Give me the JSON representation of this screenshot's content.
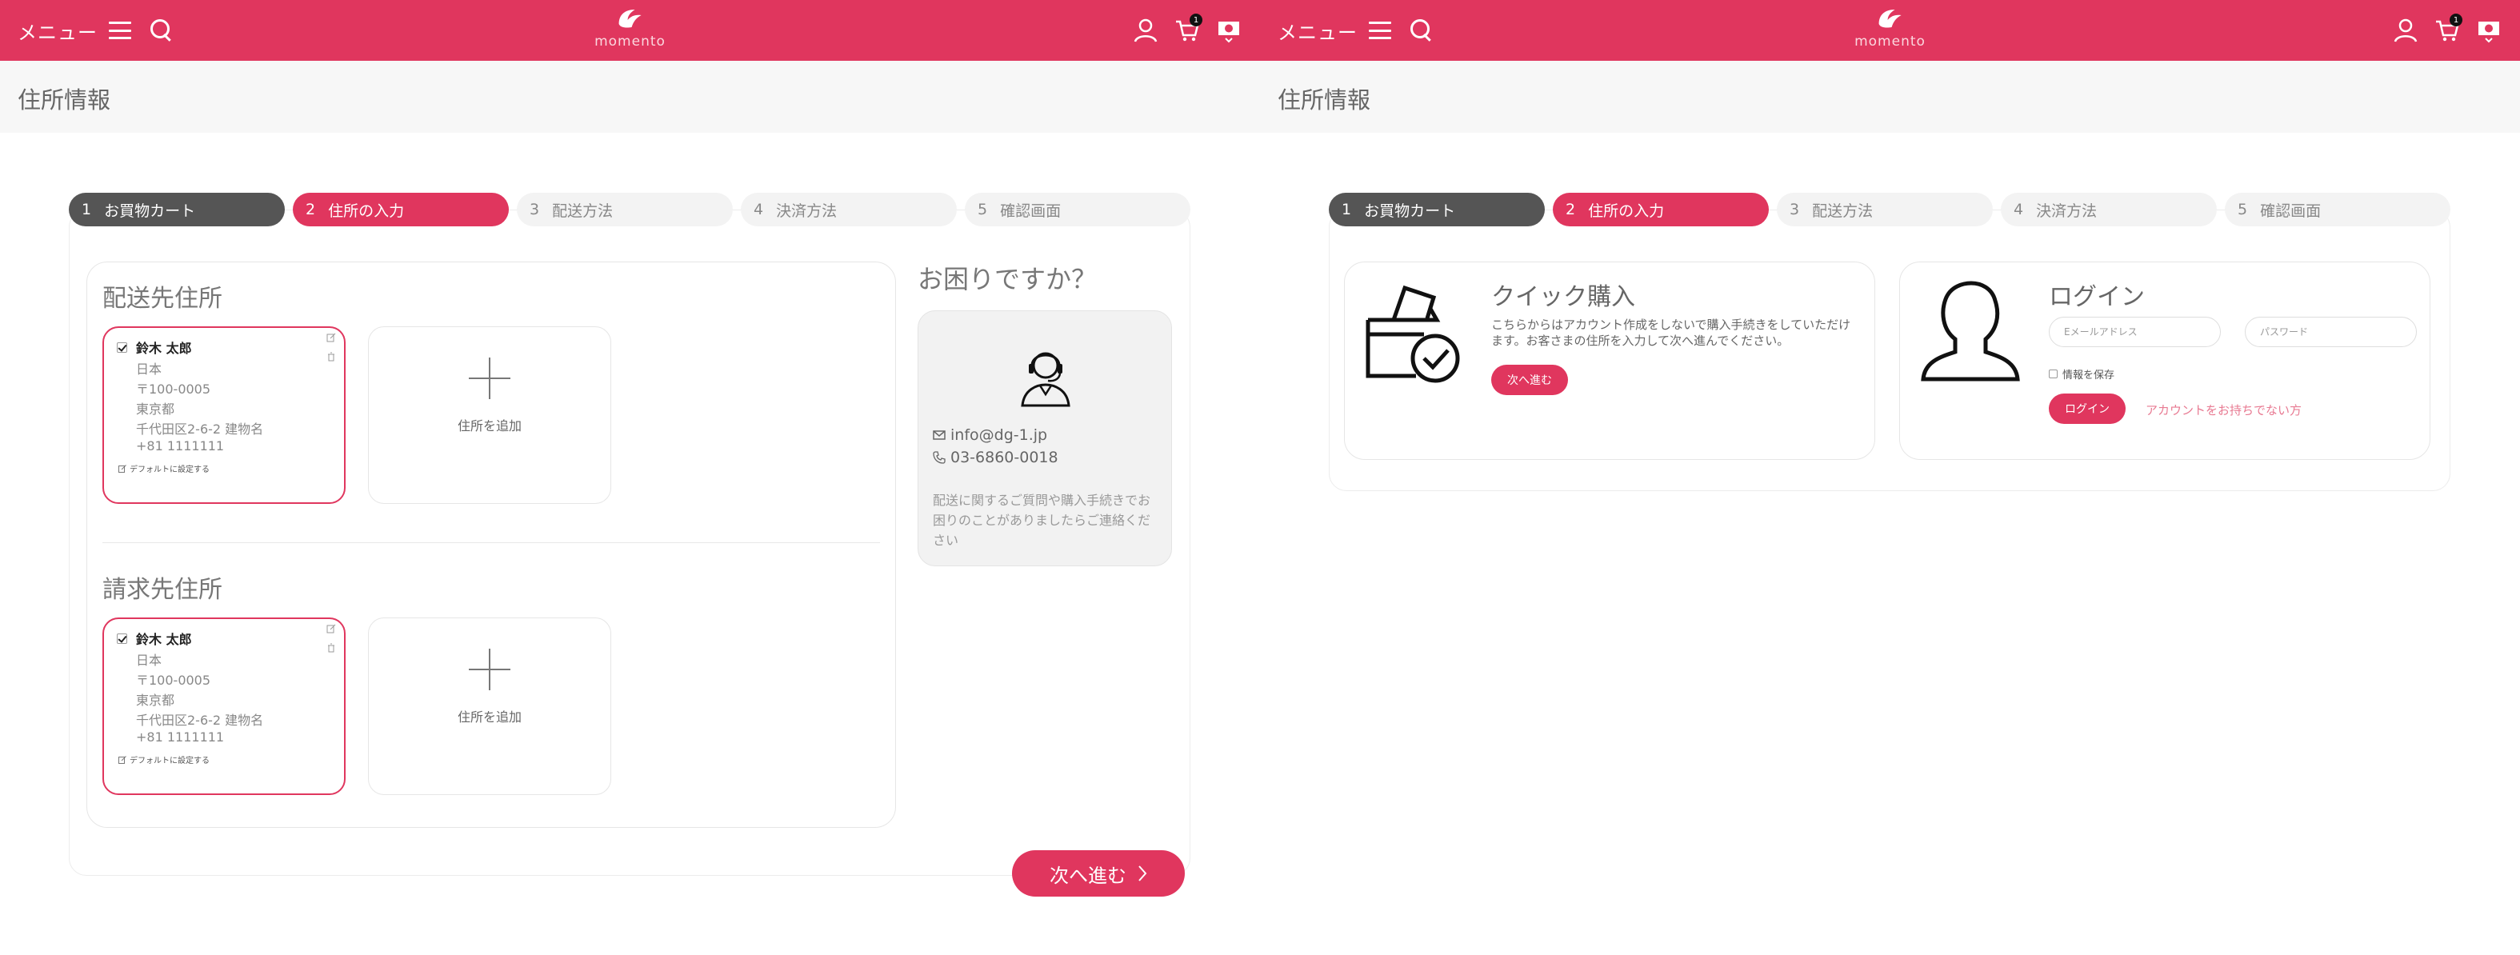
{
  "header": {
    "menu_label": "メニュー",
    "brand": "momento",
    "cart_count": "1"
  },
  "page_title": "住所情報",
  "steps": [
    {
      "num": "1",
      "label": "お買物カート",
      "state": "done"
    },
    {
      "num": "2",
      "label": "住所の入力",
      "state": "active"
    },
    {
      "num": "3",
      "label": "配送方法",
      "state": "todo"
    },
    {
      "num": "4",
      "label": "決済方法",
      "state": "todo"
    },
    {
      "num": "5",
      "label": "確認画面",
      "state": "todo"
    }
  ],
  "shipping": {
    "title": "配送先住所",
    "address": {
      "name": "鈴木 太郎",
      "lines": [
        "日本",
        "〒100-0005",
        "東京都",
        "千代田区2-6-2 建物名",
        "+81 1111111"
      ],
      "default_label": "デフォルトに設定する"
    },
    "add_label": "住所を追加"
  },
  "billing": {
    "title": "請求先住所",
    "address": {
      "name": "鈴木 太郎",
      "lines": [
        "日本",
        "〒100-0005",
        "東京都",
        "千代田区2-6-2 建物名",
        "+81 1111111"
      ],
      "default_label": "デフォルトに設定する"
    },
    "add_label": "住所を追加"
  },
  "help": {
    "title": "お困りですか？",
    "email": "info@dg-1.jp",
    "phone": "03-6860-0018",
    "note": "配送に関するご質問や購入手続きでお困りのことがありましたらご連絡ください"
  },
  "next_button": "次へ進む",
  "quick": {
    "title": "クイック購入",
    "description": "こちらからはアカウント作成をしないで購入手続きをしていただけます。お客さまの住所を入力して次へ進んでください。",
    "button": "次へ進む"
  },
  "login": {
    "title": "ログイン",
    "email_placeholder": "Eメールアドレス",
    "password_placeholder": "パスワード",
    "save_label": "情報を保存",
    "button": "ログイン",
    "no_account": "アカウントをお持ちでない方"
  },
  "colors": {
    "accent": "#e0365e",
    "step_done": "#555555",
    "step_todo": "#f3f3f3"
  }
}
